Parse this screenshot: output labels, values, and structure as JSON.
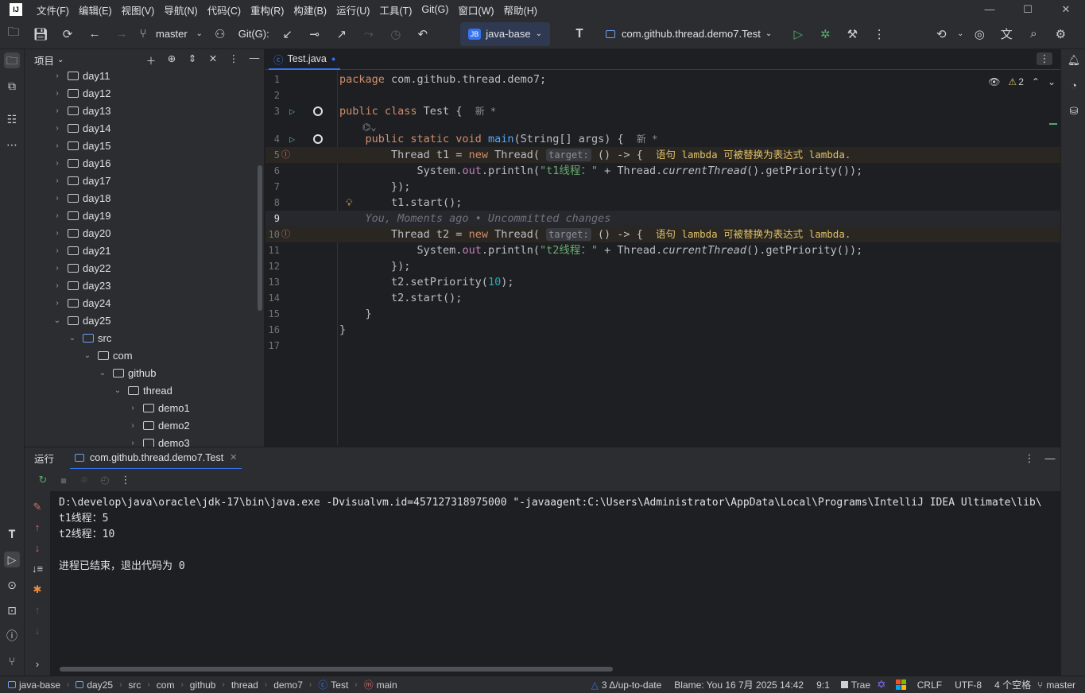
{
  "menu": [
    "文件(F)",
    "编辑(E)",
    "视图(V)",
    "导航(N)",
    "代码(C)",
    "重构(R)",
    "构建(B)",
    "运行(U)",
    "工具(T)",
    "Git(G)",
    "窗口(W)",
    "帮助(H)"
  ],
  "toolbar": {
    "branch": "master",
    "git_label": "Git(G):",
    "project_badge": "JB",
    "project": "java-base",
    "run_config": "com.github.thread.demo7.Test"
  },
  "project_panel": {
    "title": "项目",
    "items": [
      {
        "label": "day11",
        "depth": 0,
        "expanded": false,
        "type": "module"
      },
      {
        "label": "day12",
        "depth": 0,
        "expanded": false,
        "type": "module"
      },
      {
        "label": "day13",
        "depth": 0,
        "expanded": false,
        "type": "module"
      },
      {
        "label": "day14",
        "depth": 0,
        "expanded": false,
        "type": "module"
      },
      {
        "label": "day15",
        "depth": 0,
        "expanded": false,
        "type": "module"
      },
      {
        "label": "day16",
        "depth": 0,
        "expanded": false,
        "type": "module"
      },
      {
        "label": "day17",
        "depth": 0,
        "expanded": false,
        "type": "module"
      },
      {
        "label": "day18",
        "depth": 0,
        "expanded": false,
        "type": "module"
      },
      {
        "label": "day19",
        "depth": 0,
        "expanded": false,
        "type": "module"
      },
      {
        "label": "day20",
        "depth": 0,
        "expanded": false,
        "type": "module"
      },
      {
        "label": "day21",
        "depth": 0,
        "expanded": false,
        "type": "module"
      },
      {
        "label": "day22",
        "depth": 0,
        "expanded": false,
        "type": "module"
      },
      {
        "label": "day23",
        "depth": 0,
        "expanded": false,
        "type": "module"
      },
      {
        "label": "day24",
        "depth": 0,
        "expanded": false,
        "type": "module"
      },
      {
        "label": "day25",
        "depth": 0,
        "expanded": true,
        "type": "module"
      },
      {
        "label": "src",
        "depth": 1,
        "expanded": true,
        "type": "src"
      },
      {
        "label": "com",
        "depth": 2,
        "expanded": true,
        "type": "pkg"
      },
      {
        "label": "github",
        "depth": 3,
        "expanded": true,
        "type": "pkg"
      },
      {
        "label": "thread",
        "depth": 4,
        "expanded": true,
        "type": "pkg"
      },
      {
        "label": "demo1",
        "depth": 5,
        "expanded": false,
        "type": "pkg"
      },
      {
        "label": "demo2",
        "depth": 5,
        "expanded": false,
        "type": "pkg"
      },
      {
        "label": "demo3",
        "depth": 5,
        "expanded": false,
        "type": "pkg"
      }
    ]
  },
  "editor": {
    "tab": "Test.java",
    "warnings_count": "2",
    "lines": [
      {
        "n": "1",
        "html": "<span class=\"kw\">package</span><span class=\"plain\"> com.github.thread.demo7;</span>"
      },
      {
        "n": "2",
        "html": ""
      },
      {
        "n": "3",
        "html": "<span class=\"kw\">public class</span><span class=\"plain\"> Test {  </span><span class=\"new-tag\">新 *</span>"
      },
      {
        "n": "",
        "html": "<span class=\"new-tag\">    ⌬⌄</span>"
      },
      {
        "n": "4",
        "html": "    <span class=\"kw\">public static void</span> <span class=\"fn\">main</span><span class=\"plain\">(String[] args) {  </span><span class=\"new-tag\">新 *</span>"
      },
      {
        "n": "5",
        "html": "<span class=\"plain\">        Thread t1 = </span><span class=\"kw\">new</span><span class=\"plain\"> Thread( </span><span class=\"hint\">target:</span><span class=\"plain\"> () -> {  </span><span class=\"warn-txt\">语句 lambda 可被替换为表达式 lambda.</span>"
      },
      {
        "n": "6",
        "html": "<span class=\"plain\">            System.</span><span class=\"fld\">out</span><span class=\"plain\">.println(</span><span class=\"str\">\"t1线程：\"</span><span class=\"plain\"> + Thread.</span><span class=\"plain it\">currentThread</span><span class=\"plain\">().getPriority());</span>"
      },
      {
        "n": "7",
        "html": "<span class=\"plain\">        });</span>"
      },
      {
        "n": "8",
        "html": "<span class=\"plain\">        t1.start();</span>"
      },
      {
        "n": "9",
        "html": "<span class=\"blame\">    You, Moments ago • Uncommitted changes</span>"
      },
      {
        "n": "10",
        "html": "<span class=\"plain\">        Thread t2 = </span><span class=\"kw\">new</span><span class=\"plain\"> Thread( </span><span class=\"hint\">target:</span><span class=\"plain\"> () -> {  </span><span class=\"warn-txt\">语句 lambda 可被替换为表达式 lambda.</span>"
      },
      {
        "n": "11",
        "html": "<span class=\"plain\">            System.</span><span class=\"fld\">out</span><span class=\"plain\">.println(</span><span class=\"str\">\"t2线程：\"</span><span class=\"plain\"> + Thread.</span><span class=\"plain it\">currentThread</span><span class=\"plain\">().getPriority());</span>"
      },
      {
        "n": "12",
        "html": "<span class=\"plain\">        });</span>"
      },
      {
        "n": "13",
        "html": "<span class=\"plain\">        t2.setPriority(</span><span class=\"num\">10</span><span class=\"plain\">);</span>"
      },
      {
        "n": "14",
        "html": "<span class=\"plain\">        t2.start();</span>"
      },
      {
        "n": "15",
        "html": "<span class=\"plain\">    }</span>"
      },
      {
        "n": "16",
        "html": "<span class=\"plain\">}</span>"
      },
      {
        "n": "17",
        "html": ""
      }
    ]
  },
  "run_panel": {
    "title": "运行",
    "tab": "com.github.thread.demo7.Test",
    "output": [
      "D:\\develop\\java\\oracle\\jdk-17\\bin\\java.exe -Dvisualvm.id=457127318975000 \"-javaagent:C:\\Users\\Administrator\\AppData\\Local\\Programs\\IntelliJ IDEA Ultimate\\lib\\",
      "t1线程：5",
      "t2线程：10",
      "",
      "进程已结束，退出代码为 0"
    ]
  },
  "statusbar": {
    "breadcrumb": [
      "java-base",
      "day25",
      "src",
      "com",
      "github",
      "thread",
      "demo7",
      "Test",
      "main"
    ],
    "git_status": "3 Δ/up-to-date",
    "blame": "Blame: You 16 7月 2025 14:42",
    "position": "9:1",
    "trae": "Trae",
    "line_sep": "CRLF",
    "encoding": "UTF-8",
    "indent": "4 个空格",
    "branch": "master"
  }
}
